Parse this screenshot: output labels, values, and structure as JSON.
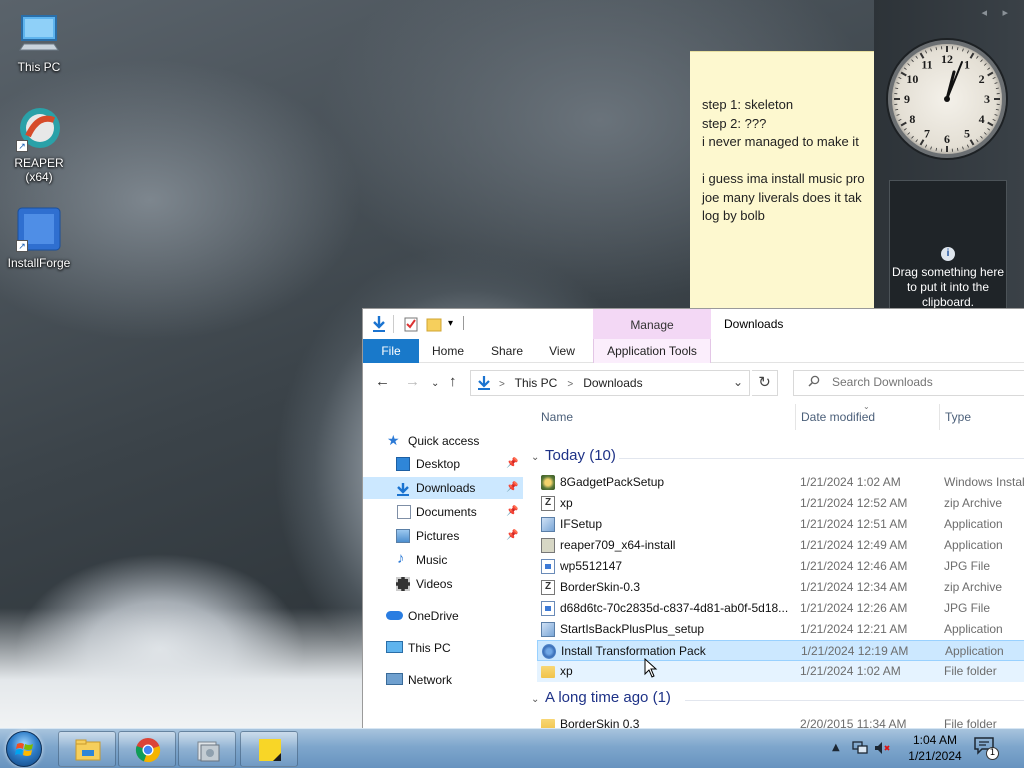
{
  "desktop": {
    "icons": [
      {
        "label": "This PC"
      },
      {
        "label": "REAPER (x64)"
      },
      {
        "label": "InstallForge"
      }
    ]
  },
  "sticky_note": {
    "lines": [
      "step 1: skeleton",
      "step 2: ???",
      "i never managed to make it",
      "",
      "i guess ima install music pro",
      "joe many liverals does it tak",
      "log by bolb"
    ]
  },
  "gadgets": {
    "nav": "◂ ▸",
    "clock_numbers": [
      "12",
      "1",
      "2",
      "3",
      "4",
      "5",
      "6",
      "7",
      "8",
      "9",
      "10",
      "11"
    ],
    "clipboard_info": "i",
    "clipboard_message": "Drag something here to put it into the clipboard."
  },
  "explorer": {
    "title": "Downloads",
    "contextual_tab": "Manage",
    "ribbon_tabs": {
      "file": "File",
      "home": "Home",
      "share": "Share",
      "view": "View",
      "app_tools": "Application Tools"
    },
    "address": {
      "path": [
        "This PC",
        "Downloads"
      ],
      "separator": ">"
    },
    "search": {
      "placeholder": "Search Downloads"
    },
    "nav_pane": {
      "quick_access": "Quick access",
      "items": [
        {
          "label": "Desktop",
          "pinned": true
        },
        {
          "label": "Downloads",
          "pinned": true
        },
        {
          "label": "Documents",
          "pinned": true
        },
        {
          "label": "Pictures",
          "pinned": true
        },
        {
          "label": "Music",
          "pinned": false
        },
        {
          "label": "Videos",
          "pinned": false
        }
      ],
      "onedrive": "OneDrive",
      "this_pc": "This PC",
      "network": "Network"
    },
    "columns": {
      "name": "Name",
      "date": "Date modified",
      "type": "Type"
    },
    "groups": [
      {
        "label": "Today (10)",
        "files": [
          {
            "name": "8GadgetPackSetup",
            "date": "1/21/2024 1:02 AM",
            "type": "Windows Instal",
            "icon": "gear-icon"
          },
          {
            "name": "xp",
            "date": "1/21/2024 12:52 AM",
            "type": "zip Archive",
            "icon": "zip-icon"
          },
          {
            "name": "IFSetup",
            "date": "1/21/2024 12:51 AM",
            "type": "Application",
            "icon": "app-icon"
          },
          {
            "name": "reaper709_x64-install",
            "date": "1/21/2024 12:49 AM",
            "type": "Application",
            "icon": "reaper-installer-icon"
          },
          {
            "name": "wp5512147",
            "date": "1/21/2024 12:46 AM",
            "type": "JPG File",
            "icon": "jpg-icon"
          },
          {
            "name": "BorderSkin-0.3",
            "date": "1/21/2024 12:34 AM",
            "type": "zip Archive",
            "icon": "zip-icon"
          },
          {
            "name": "d68d6tc-70c2835d-c837-4d81-ab0f-5d18...",
            "date": "1/21/2024 12:26 AM",
            "type": "JPG File",
            "icon": "jpg-icon"
          },
          {
            "name": "StartIsBackPlusPlus_setup",
            "date": "1/21/2024 12:21 AM",
            "type": "Application",
            "icon": "app-icon"
          },
          {
            "name": "Install Transformation Pack",
            "date": "1/21/2024 12:19 AM",
            "type": "Application",
            "icon": "pack-icon"
          },
          {
            "name": "xp",
            "date": "1/21/2024 1:02 AM",
            "type": "File folder",
            "icon": "folder-icon"
          }
        ]
      },
      {
        "label": "A long time ago (1)",
        "files": [
          {
            "name": "BorderSkin 0.3",
            "date": "2/20/2015 11:34 AM",
            "type": "File folder",
            "icon": "folder-icon"
          }
        ]
      }
    ]
  },
  "taskbar": {
    "time": "1:04 AM",
    "date": "1/21/2024",
    "notification_count": "1"
  }
}
